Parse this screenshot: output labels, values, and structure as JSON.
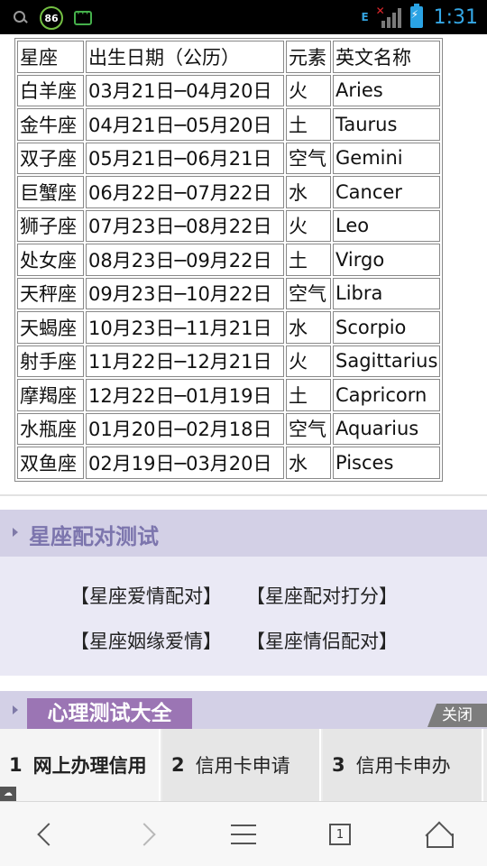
{
  "status_bar": {
    "notification_badge": "86",
    "network_type": "E",
    "time": "1:31"
  },
  "zodiac_table": {
    "headers": [
      "星座",
      "出生日期（公历）",
      "元素",
      "英文名称"
    ],
    "rows": [
      [
        "白羊座",
        "03月21日─04月20日",
        "火",
        "Aries"
      ],
      [
        "金牛座",
        "04月21日─05月20日",
        "土",
        "Taurus"
      ],
      [
        "双子座",
        "05月21日─06月21日",
        "空气",
        "Gemini"
      ],
      [
        "巨蟹座",
        "06月22日─07月22日",
        "水",
        "Cancer"
      ],
      [
        "狮子座",
        "07月23日─08月22日",
        "火",
        "Leo"
      ],
      [
        "处女座",
        "08月23日─09月22日",
        "土",
        "Virgo"
      ],
      [
        "天秤座",
        "09月23日─10月22日",
        "空气",
        "Libra"
      ],
      [
        "天蝎座",
        "10月23日─11月21日",
        "水",
        "Scorpio"
      ],
      [
        "射手座",
        "11月22日─12月21日",
        "火",
        "Sagittarius"
      ],
      [
        "摩羯座",
        "12月22日─01月19日",
        "土",
        "Capricorn"
      ],
      [
        "水瓶座",
        "01月20日─02月18日",
        "空气",
        "Aquarius"
      ],
      [
        "双鱼座",
        "02月19日─03月20日",
        "水",
        "Pisces"
      ]
    ]
  },
  "section_match": {
    "title": "星座配对测试",
    "links": [
      "【星座爱情配对】",
      "【星座配对打分】",
      "【星座姻缘爱情】",
      "【星座情侣配对】"
    ]
  },
  "section_psych": {
    "title": "心理测试大全",
    "close_label": "关闭"
  },
  "ad_bar": {
    "items": [
      {
        "num": "1",
        "label": "网上办理信用"
      },
      {
        "num": "2",
        "label": "信用卡申请"
      },
      {
        "num": "3",
        "label": "信用卡申办"
      }
    ]
  },
  "nav_bar": {
    "tab_count": "1"
  },
  "colors": {
    "section_header_bg": "#d3d0e6",
    "section_title": "#7c75ad",
    "section_body_bg": "#eae9f5",
    "psych_title_bg": "#9b75b4",
    "time_color": "#35a8e6"
  }
}
